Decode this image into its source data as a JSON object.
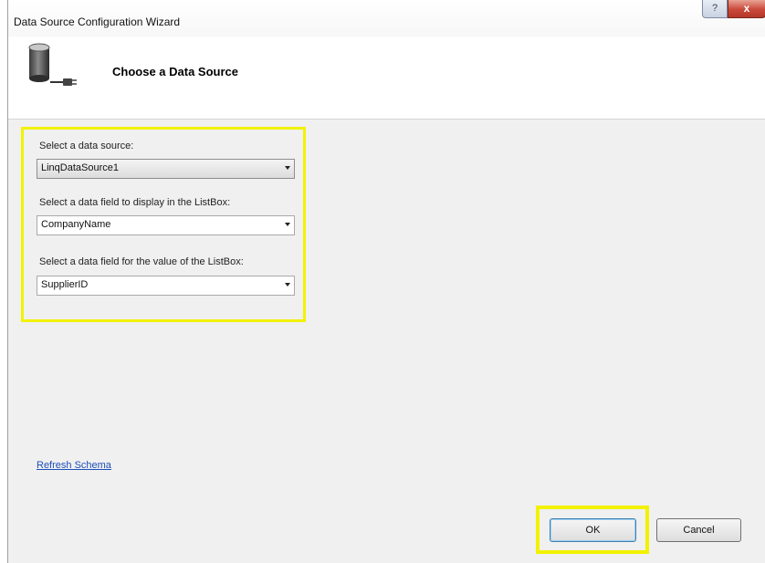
{
  "window": {
    "title": "Data Source Configuration Wizard",
    "help_glyph": "?",
    "close_glyph": "x"
  },
  "header": {
    "icon": "database-connect-icon",
    "title": "Choose a Data Source"
  },
  "fields": [
    {
      "label": "Select a data source:",
      "value": "LinqDataSource1"
    },
    {
      "label": "Select a data field to display in the ListBox:",
      "value": "CompanyName"
    },
    {
      "label": "Select a data field for the value of the ListBox:",
      "value": "SupplierID"
    }
  ],
  "links": {
    "refresh_schema": "Refresh Schema"
  },
  "buttons": {
    "ok": "OK",
    "cancel": "Cancel"
  },
  "colors": {
    "highlight": "#f2f200",
    "link": "#1c4fb8"
  }
}
